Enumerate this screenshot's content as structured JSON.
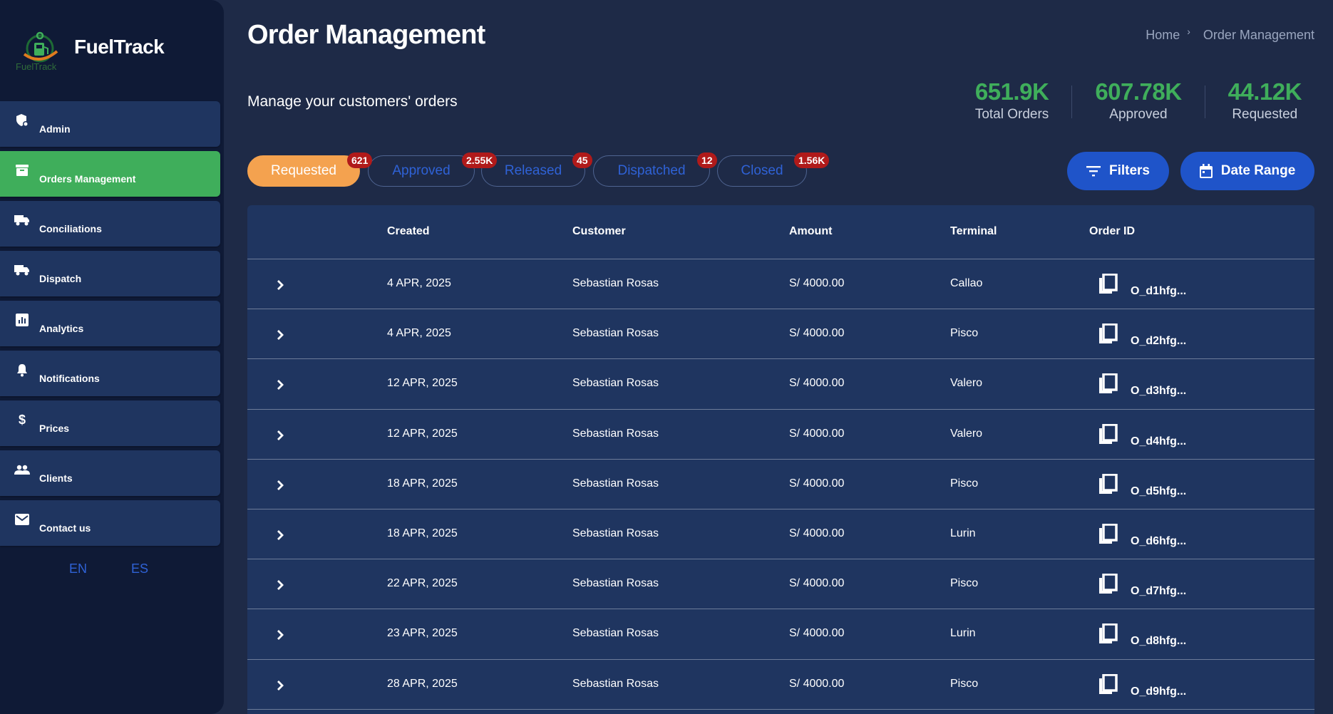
{
  "app": {
    "name": "FuelTrack",
    "logo_caption": "FuelTrack"
  },
  "sidebar": {
    "items": [
      {
        "label": "Admin",
        "icon": "shield-icon",
        "active": false
      },
      {
        "label": "Orders Management",
        "icon": "archive-icon",
        "active": true
      },
      {
        "label": "Conciliations",
        "icon": "truck-icon",
        "active": false
      },
      {
        "label": "Dispatch",
        "icon": "truck-icon",
        "active": false
      },
      {
        "label": "Analytics",
        "icon": "bar-chart-icon",
        "active": false
      },
      {
        "label": "Notifications",
        "icon": "bell-icon",
        "active": false
      },
      {
        "label": "Prices",
        "icon": "dollar-icon",
        "active": false
      },
      {
        "label": "Clients",
        "icon": "people-icon",
        "active": false
      },
      {
        "label": "Contact us",
        "icon": "mail-icon",
        "active": false
      }
    ],
    "languages": [
      "EN",
      "ES"
    ]
  },
  "header": {
    "title": "Order Management",
    "subtitle": "Manage your customers' orders",
    "breadcrumb": [
      "Home",
      "Order Management"
    ]
  },
  "stats": [
    {
      "value": "651.9K",
      "label": "Total Orders"
    },
    {
      "value": "607.78K",
      "label": "Approved"
    },
    {
      "value": "44.12K",
      "label": "Requested"
    }
  ],
  "tabs": [
    {
      "label": "Requested",
      "badge": "621",
      "active": true
    },
    {
      "label": "Approved",
      "badge": "2.55K",
      "active": false
    },
    {
      "label": "Released",
      "badge": "45",
      "active": false
    },
    {
      "label": "Dispatched",
      "badge": "12",
      "active": false
    },
    {
      "label": "Closed",
      "badge": "1.56K",
      "active": false
    }
  ],
  "buttons": {
    "filters": "Filters",
    "date_range": "Date Range"
  },
  "table": {
    "columns": [
      "Created",
      "Customer",
      "Amount",
      "Terminal",
      "Order ID"
    ],
    "rows": [
      {
        "created": "4 APR, 2025",
        "customer": "Sebastian Rosas",
        "amount": "S/ 4000.00",
        "terminal": "Callao",
        "order_id": "O_d1hfg..."
      },
      {
        "created": "4 APR, 2025",
        "customer": "Sebastian Rosas",
        "amount": "S/ 4000.00",
        "terminal": "Pisco",
        "order_id": "O_d2hfg..."
      },
      {
        "created": "12 APR, 2025",
        "customer": "Sebastian Rosas",
        "amount": "S/ 4000.00",
        "terminal": "Valero",
        "order_id": "O_d3hfg..."
      },
      {
        "created": "12 APR, 2025",
        "customer": "Sebastian Rosas",
        "amount": "S/ 4000.00",
        "terminal": "Valero",
        "order_id": "O_d4hfg..."
      },
      {
        "created": "18 APR, 2025",
        "customer": "Sebastian Rosas",
        "amount": "S/ 4000.00",
        "terminal": "Pisco",
        "order_id": "O_d5hfg..."
      },
      {
        "created": "18 APR, 2025",
        "customer": "Sebastian Rosas",
        "amount": "S/ 4000.00",
        "terminal": "Lurin",
        "order_id": "O_d6hfg..."
      },
      {
        "created": "22 APR, 2025",
        "customer": "Sebastian Rosas",
        "amount": "S/ 4000.00",
        "terminal": "Pisco",
        "order_id": "O_d7hfg..."
      },
      {
        "created": "23 APR, 2025",
        "customer": "Sebastian Rosas",
        "amount": "S/ 4000.00",
        "terminal": "Lurin",
        "order_id": "O_d8hfg..."
      },
      {
        "created": "28 APR, 2025",
        "customer": "Sebastian Rosas",
        "amount": "S/ 4000.00",
        "terminal": "Pisco",
        "order_id": "O_d9hfg..."
      }
    ]
  },
  "colors": {
    "background": "#1e2a47",
    "sidebar": "#0f1a36",
    "panel": "#1f3560",
    "active_nav": "#3fae5b",
    "stat_value": "#3fae5b",
    "active_tab": "#f4a24f",
    "tab_text": "#2f62d6",
    "badge": "#b01a1a",
    "button": "#1f54c9"
  }
}
